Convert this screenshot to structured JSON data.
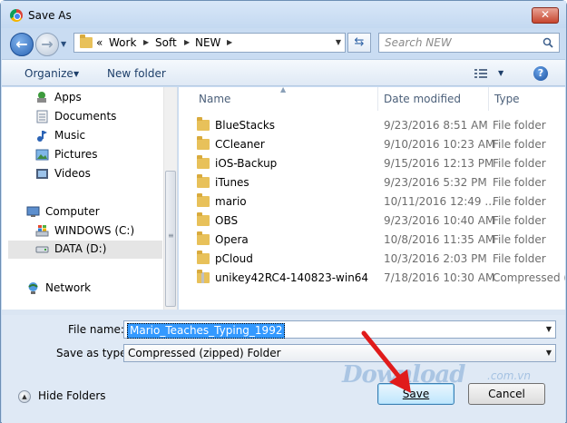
{
  "window": {
    "title": "Save As",
    "close_glyph": "✕"
  },
  "address": {
    "overflow": "«",
    "crumbs": [
      "Work",
      "Soft",
      "NEW"
    ],
    "search_placeholder": "Search NEW"
  },
  "toolbar": {
    "organize": "Organize",
    "new_folder": "New folder",
    "help": "?"
  },
  "nav": {
    "items": [
      {
        "label": "Apps",
        "icon": "apps-icon"
      },
      {
        "label": "Documents",
        "icon": "documents-icon"
      },
      {
        "label": "Music",
        "icon": "music-icon"
      },
      {
        "label": "Pictures",
        "icon": "pictures-icon"
      },
      {
        "label": "Videos",
        "icon": "videos-icon"
      },
      {
        "label": "Computer",
        "icon": "computer-icon"
      },
      {
        "label": "WINDOWS (C:)",
        "icon": "windows-drive-icon"
      },
      {
        "label": "DATA (D:)",
        "icon": "drive-icon",
        "selected": true
      },
      {
        "label": "Network",
        "icon": "network-icon"
      }
    ]
  },
  "files": {
    "columns": [
      "Name",
      "Date modified",
      "Type"
    ],
    "rows": [
      {
        "name": "BlueStacks",
        "date": "9/23/2016 8:51 AM",
        "type": "File folder"
      },
      {
        "name": "CCleaner",
        "date": "9/10/2016 10:23 AM",
        "type": "File folder"
      },
      {
        "name": "iOS-Backup",
        "date": "9/15/2016 12:13 PM",
        "type": "File folder"
      },
      {
        "name": "iTunes",
        "date": "9/23/2016 5:32 PM",
        "type": "File folder"
      },
      {
        "name": "mario",
        "date": "10/11/2016 12:49 ...",
        "type": "File folder"
      },
      {
        "name": "OBS",
        "date": "9/23/2016 10:40 AM",
        "type": "File folder"
      },
      {
        "name": "Opera",
        "date": "10/8/2016 11:35 AM",
        "type": "File folder"
      },
      {
        "name": "pCloud",
        "date": "10/3/2016 2:03 PM",
        "type": "File folder"
      },
      {
        "name": "unikey42RC4-140823-win64",
        "date": "7/18/2016 10:30 AM",
        "type": "Compressed (z"
      }
    ]
  },
  "form": {
    "filename_label": "File name:",
    "filename_value": "Mario_Teaches_Typing_1992",
    "type_label": "Save as type:",
    "type_value": "Compressed (zipped) Folder",
    "hide_folders": "Hide Folders",
    "save": "Save",
    "cancel": "Cancel"
  },
  "watermark": {
    "text": "Download",
    "tld": ".com.vn"
  }
}
